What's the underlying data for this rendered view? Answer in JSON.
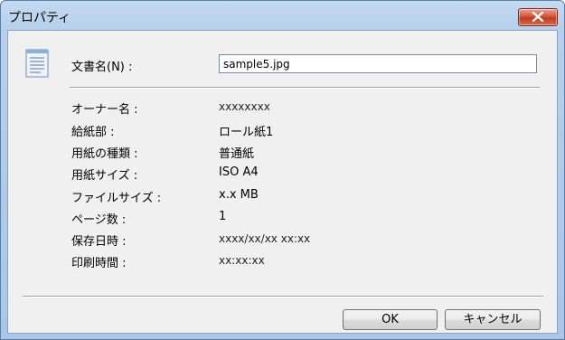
{
  "window": {
    "title": "プロパティ"
  },
  "document_name": {
    "label": "文書名(N) :",
    "value": "sample5.jpg"
  },
  "properties": [
    {
      "label": "オーナー名 :",
      "value": "xxxxxxxx"
    },
    {
      "label": "給紙部 :",
      "value": "ロール紙1"
    },
    {
      "label": "用紙の種類 :",
      "value": "普通紙"
    },
    {
      "label": "用紙サイズ :",
      "value": "ISO A4"
    },
    {
      "label": "ファイルサイズ :",
      "value": "x.x MB"
    },
    {
      "label": "ページ数 :",
      "value": "1"
    },
    {
      "label": "保存日時 :",
      "value": "xxxx/xx/xx xx:xx"
    },
    {
      "label": "印刷時間 :",
      "value": "xx:xx:xx"
    }
  ],
  "buttons": {
    "ok": "OK",
    "cancel": "キャンセル"
  }
}
